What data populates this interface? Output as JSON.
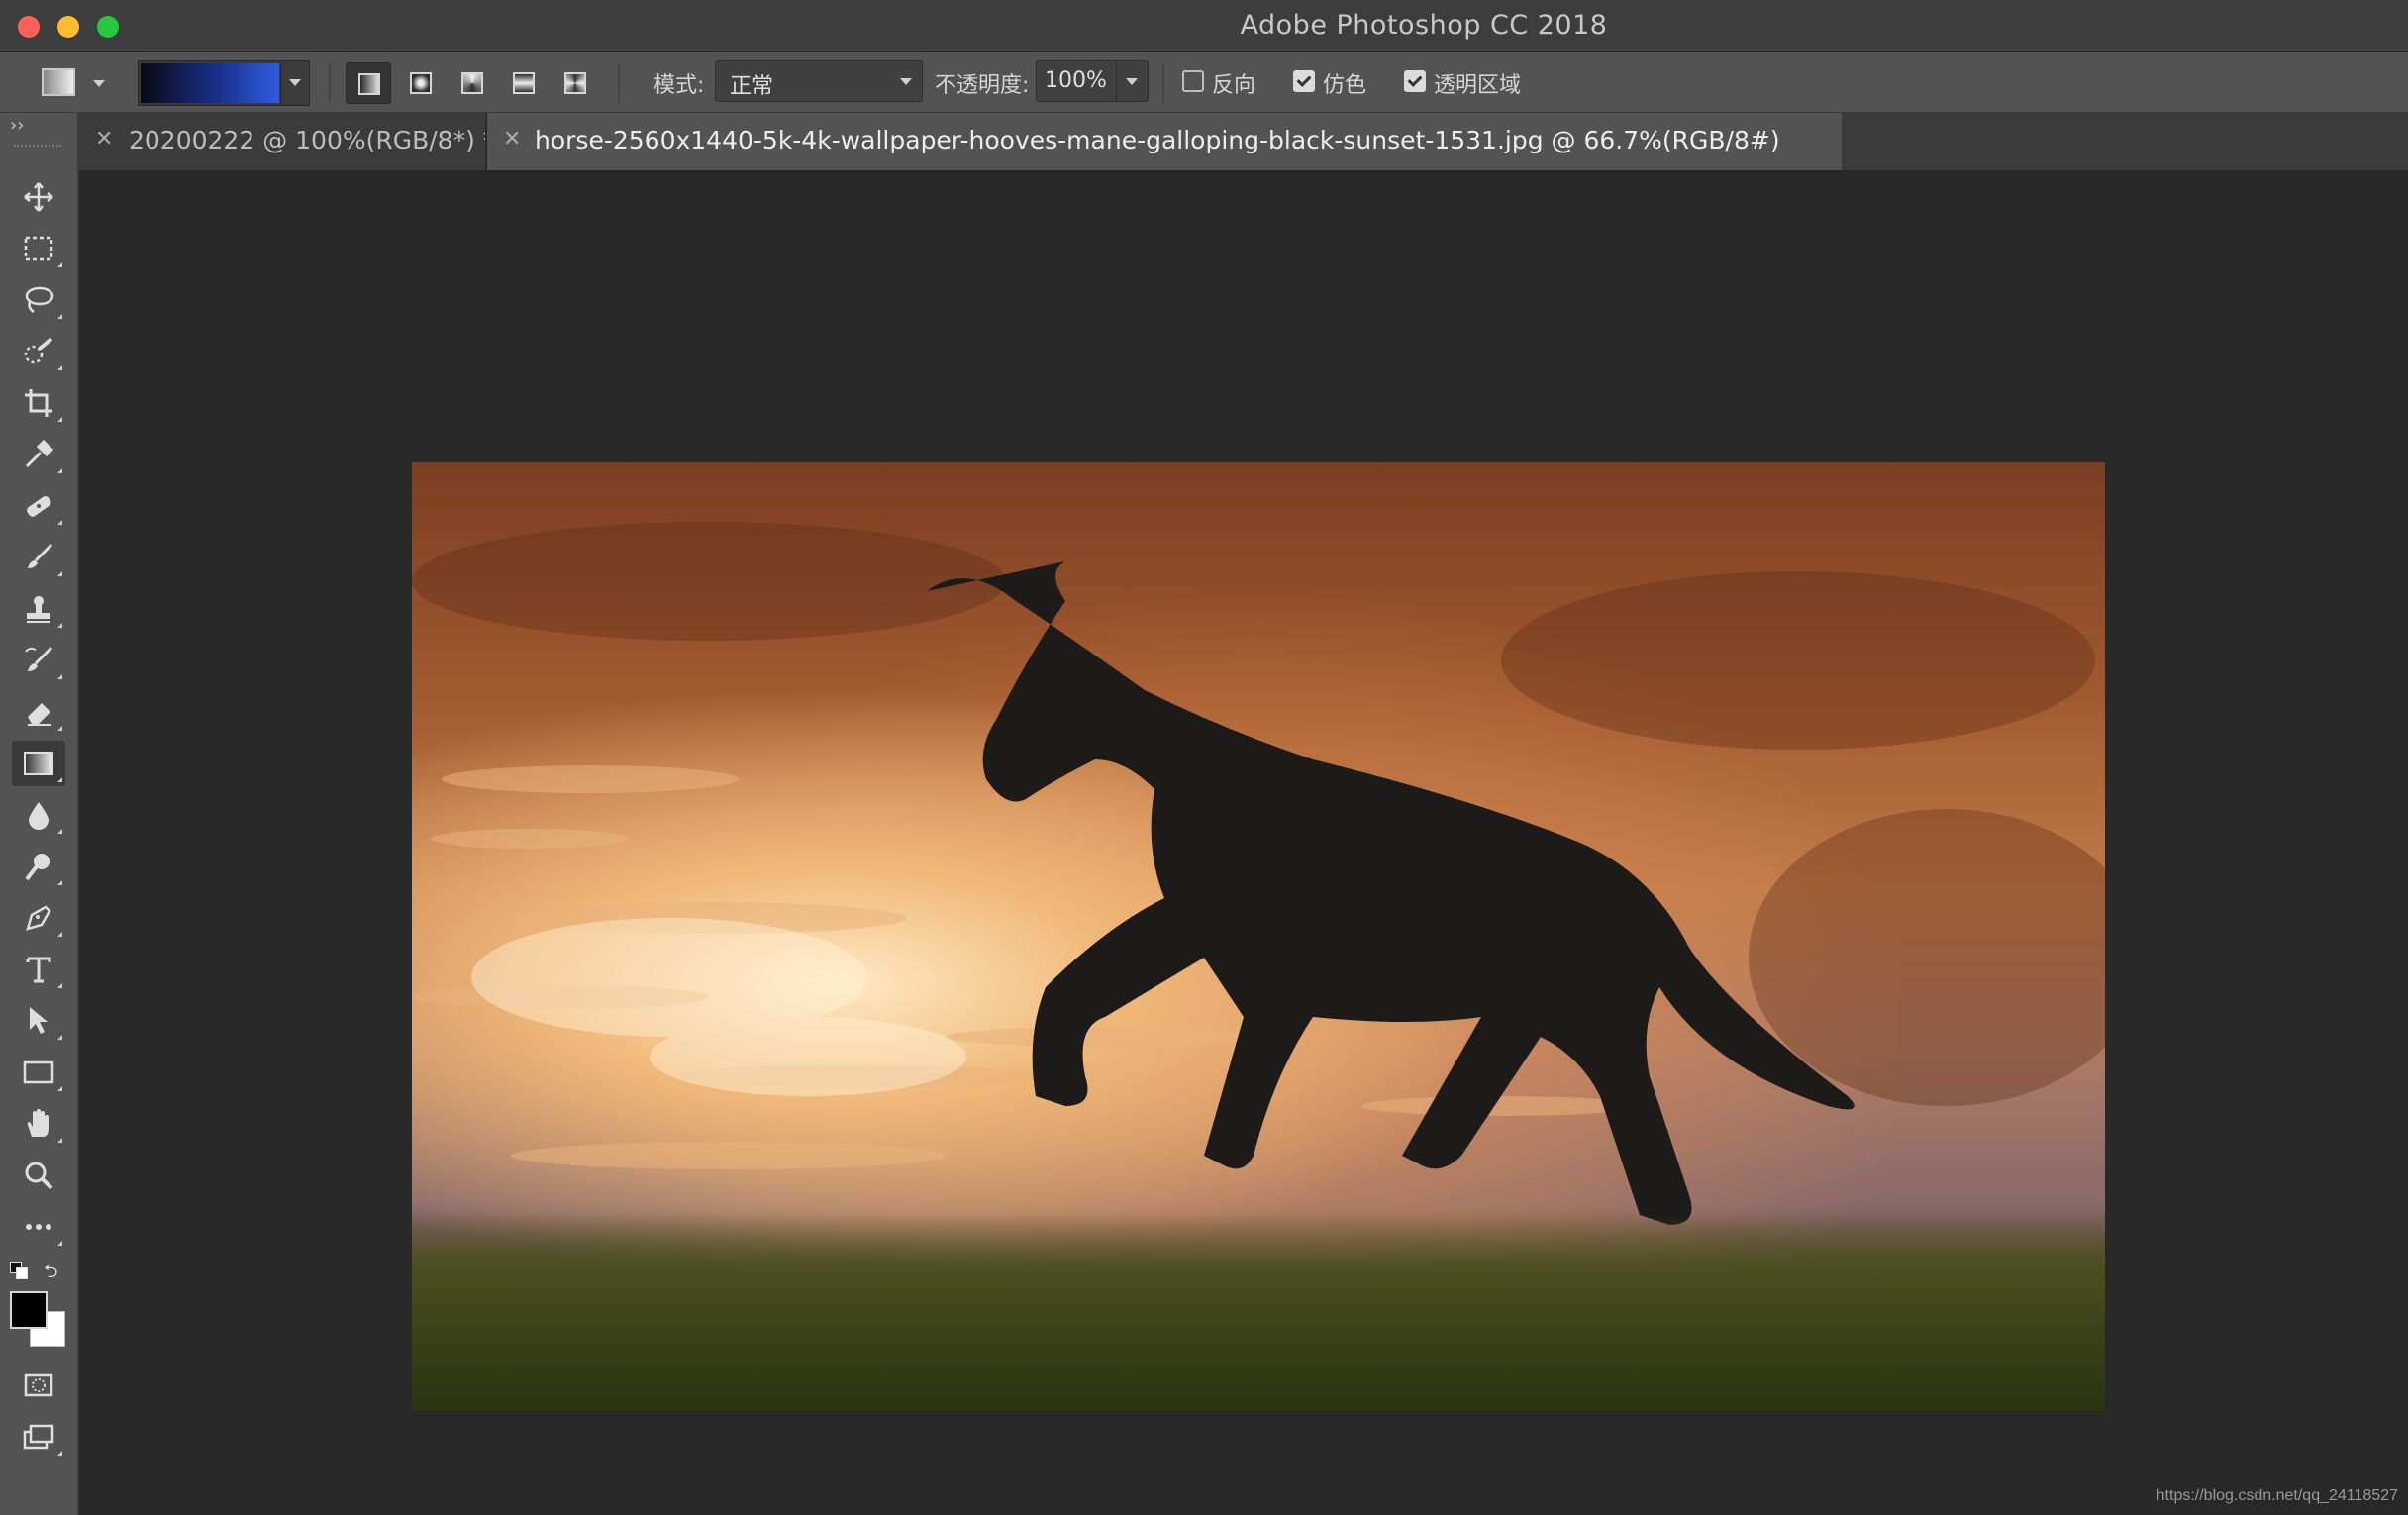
{
  "app": {
    "title": "Adobe Photoshop CC 2018"
  },
  "options_bar": {
    "mode_label": "模式:",
    "mode_value": "正常",
    "opacity_label": "不透明度:",
    "opacity_value": "100%",
    "reverse_label": "反向",
    "reverse_checked": false,
    "dither_label": "仿色",
    "dither_checked": true,
    "transparency_label": "透明区域",
    "transparency_checked": true,
    "selected_gradient_type": "linear"
  },
  "tabs": [
    {
      "label": "20200222 @ 100%(RGB/8*) *",
      "active": false
    },
    {
      "label": "horse-2560x1440-5k-4k-wallpaper-hooves-mane-galloping-black-sunset-1531.jpg @ 66.7%(RGB/8#)",
      "active": true
    }
  ],
  "toolbar": {
    "collapse_glyph": "››",
    "tools": [
      "move-tool",
      "rectangular-marquee-tool",
      "lasso-tool",
      "quick-selection-tool",
      "crop-tool",
      "eyedropper-tool",
      "healing-brush-tool",
      "brush-tool",
      "clone-stamp-tool",
      "history-brush-tool",
      "eraser-tool",
      "gradient-tool",
      "blur-tool",
      "dodge-tool",
      "pen-tool",
      "type-tool",
      "path-selection-tool",
      "rectangle-tool",
      "hand-tool",
      "zoom-tool",
      "edit-toolbar"
    ],
    "selected_tool": "gradient-tool",
    "foreground_color": "#000000",
    "background_color": "#ffffff"
  },
  "canvas": {
    "image_description_icon": "horse-photo"
  },
  "watermark": "https://blog.csdn.net/qq_24118527"
}
